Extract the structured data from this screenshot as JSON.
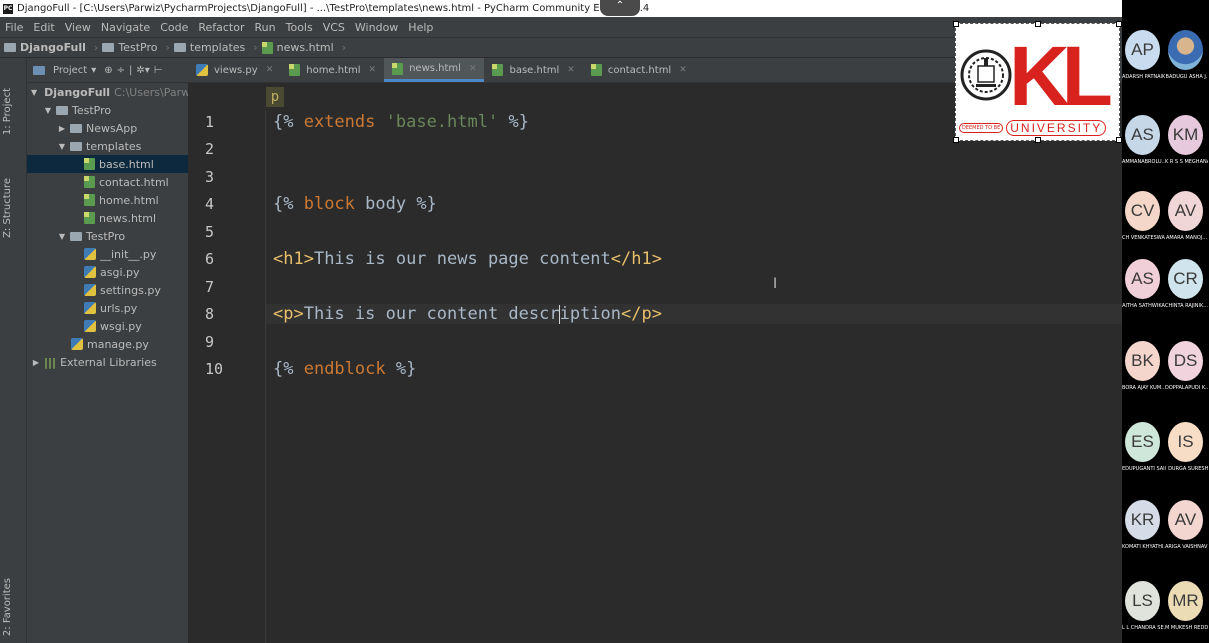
{
  "window": {
    "title": "DjangoFull - [C:\\Users\\Parwiz\\PycharmProjects\\DjangoFull] - ...\\TestPro\\templates\\news.html - PyCharm Community Editi",
    "version_fragment": "17.1.4"
  },
  "menu": [
    "File",
    "Edit",
    "View",
    "Navigate",
    "Code",
    "Refactor",
    "Run",
    "Tools",
    "VCS",
    "Window",
    "Help"
  ],
  "breadcrumb": [
    "DjangoFull",
    "TestPro",
    "templates",
    "news.html"
  ],
  "left_stripe": {
    "project": "1: Project",
    "structure": "Z: Structure",
    "favorites": "2: Favorites"
  },
  "project_panel": {
    "header": "Project",
    "root": "DjangoFull",
    "root_path": "C:\\Users\\Parw",
    "items": {
      "testpro": "TestPro",
      "newsapp": "NewsApp",
      "templates": "templates",
      "base": "base.html",
      "contact": "contact.html",
      "home": "home.html",
      "news": "news.html",
      "testpro_pkg": "TestPro",
      "init": "__init__.py",
      "asgi": "asgi.py",
      "settings": "settings.py",
      "urls": "urls.py",
      "wsgi": "wsgi.py",
      "manage": "manage.py",
      "external": "External Libraries"
    }
  },
  "tabs": [
    "views.py",
    "home.html",
    "news.html",
    "base.html",
    "contact.html"
  ],
  "active_tab": "news.html",
  "tag_crumb": "p",
  "code": {
    "l1_open": "{% ",
    "l1_kw": "extends",
    "l1_str": "'base.html'",
    "l1_close": " %}",
    "l4_open": "{% ",
    "l4_kw": "block",
    "l4_rest": " body %}",
    "l6_open": "<h1>",
    "l6_text": "This is our news page content",
    "l6_close": "</h1>",
    "l8_open": "<p>",
    "l8_text_a": "This is our content descr",
    "l8_text_b": "iption",
    "l8_close": "</p>",
    "l10_open": "{% ",
    "l10_kw": "endblock",
    "l10_close": " %}"
  },
  "line_numbers": [
    "1",
    "2",
    "3",
    "4",
    "5",
    "6",
    "7",
    "8",
    "9",
    "10"
  ],
  "logo": {
    "brand": "KL",
    "deemed": "DEEMED TO BE",
    "university": "UNIVERSITY"
  },
  "participants": [
    {
      "initials": "AP",
      "name": "ADARSH PATNAIK",
      "color": "#c9dcef"
    },
    {
      "initials": "",
      "name": "BADUGU ASHA J.",
      "color": "#7fb3d8",
      "photo": true
    },
    {
      "initials": "AS",
      "name": "AMMANABROLU...",
      "color": "#c6d8e8"
    },
    {
      "initials": "KM",
      "name": "K R S S MEGHANA",
      "color": "#e7c9dd"
    },
    {
      "initials": "CV",
      "name": "CH VENKATESWAR",
      "color": "#f4d7c8"
    },
    {
      "initials": "AV",
      "name": "AMARA MANOJ...",
      "color": "#f1d6d8"
    },
    {
      "initials": "AS",
      "name": "AITHA SATHWIKA",
      "color": "#f1cfd8"
    },
    {
      "initials": "CR",
      "name": "CHINTA RAJINIK...",
      "color": "#cfe4ec"
    },
    {
      "initials": "BK",
      "name": "BORA AJAY KUM...",
      "color": "#f5d6cc"
    },
    {
      "initials": "DS",
      "name": "DOPPALAPUDI K...",
      "color": "#f0d3dc"
    },
    {
      "initials": "ES",
      "name": "EDUPUGANTI SAI...",
      "color": "#cfe6da"
    },
    {
      "initials": "IS",
      "name": "I DURGA SURESH",
      "color": "#f7dcc6"
    },
    {
      "initials": "KR",
      "name": "KOMATI KHYATHI...",
      "color": "#d5dce8"
    },
    {
      "initials": "AV",
      "name": "ARIGA VAISHNAVI",
      "color": "#f3d6cf"
    },
    {
      "initials": "LS",
      "name": "L L CHANDRA SE...",
      "color": "#dfe3dc"
    },
    {
      "initials": "MR",
      "name": "M MUKESH REDDY",
      "color": "#ecdcb6"
    }
  ]
}
